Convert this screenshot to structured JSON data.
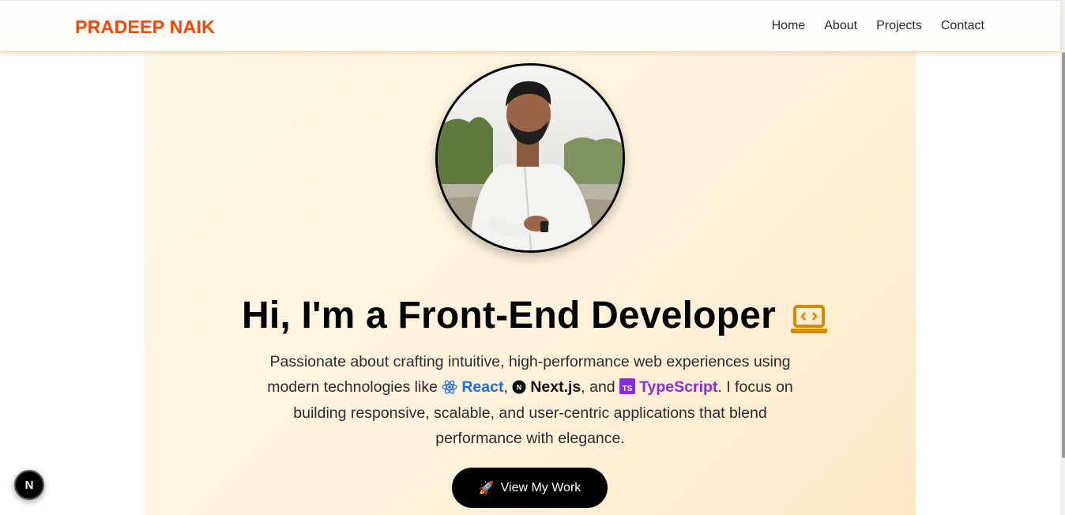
{
  "nav": {
    "brand": "PRADEEP NAIK",
    "links": [
      "Home",
      "About",
      "Projects",
      "Contact"
    ]
  },
  "hero": {
    "headline": "Hi, I'm a Front-End Developer",
    "headline_icon": "laptop-code-icon",
    "desc": {
      "part1": "Passionate about crafting intuitive, high-performance web experiences using modern technologies like",
      "react": "React",
      "sep1": ",",
      "next": "Next.js",
      "sep2": ", and",
      "ts": "TypeScript",
      "part2": ". I focus on building responsive, scalable, and user-centric applications that blend performance with elegance."
    },
    "cta_label": "View My Work",
    "cta_icon": "rocket-icon"
  },
  "dev_badge": "N",
  "colors": {
    "brand": "#ff4500",
    "react": "#1a6fe8",
    "typescript": "#8a2be2",
    "laptop_icon": "#d98a00",
    "cta_bg": "#000000"
  }
}
